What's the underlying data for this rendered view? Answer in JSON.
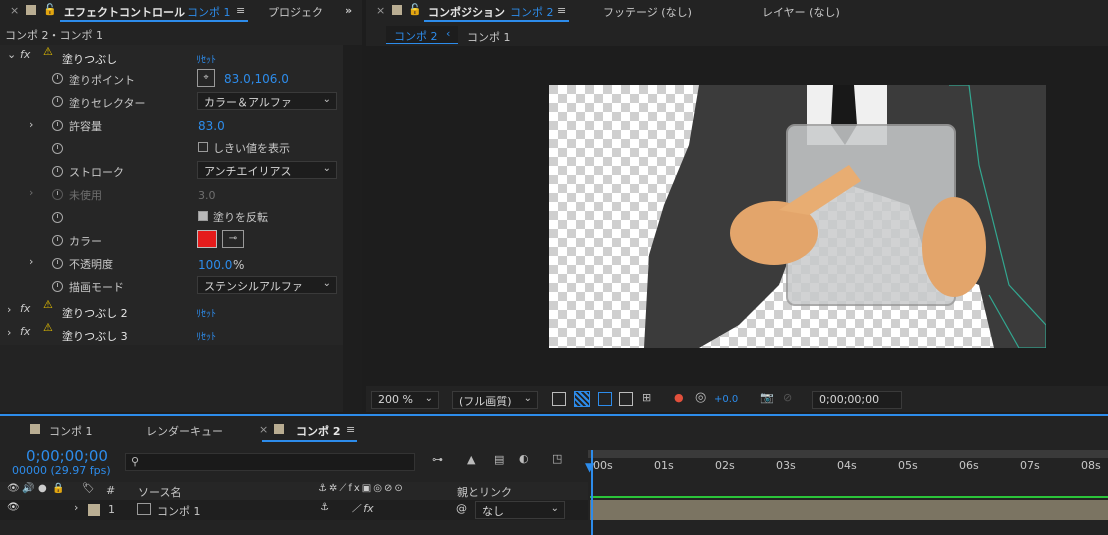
{
  "effect_panel": {
    "tab_label": "エフェクトコントロール",
    "tab_comp": "コンポ 1",
    "project_tab": "プロジェク",
    "header": "コンポ 2・コンポ 1",
    "effects": [
      {
        "name": "塗りつぶし",
        "reset": "ﾘｾｯﾄ"
      },
      {
        "name": "塗りつぶし 2",
        "reset": "ﾘｾｯﾄ"
      },
      {
        "name": "塗りつぶし 3",
        "reset": "ﾘｾｯﾄ"
      }
    ],
    "props": {
      "fill_point_label": "塗りポイント",
      "fill_point_value": "83.0,106.0",
      "selector_label": "塗りセレクター",
      "selector_value": "カラー＆アルファ",
      "tolerance_label": "許容量",
      "tolerance_value": "83.0",
      "threshold_label": "しきい値を表示",
      "stroke_label": "ストローク",
      "stroke_value": "アンチエイリアス",
      "unused_label": "未使用",
      "unused_value": "3.0",
      "invert_label": "塗りを反転",
      "color_label": "カラー",
      "color_value": "#e51c1c",
      "opacity_label": "不透明度",
      "opacity_value": "100.0",
      "opacity_unit": "%",
      "blend_label": "描画モード",
      "blend_value": "ステンシルアルファ"
    }
  },
  "comp_panel": {
    "tab_label": "コンポジション",
    "tab_comp": "コンポ 2",
    "footage_tab": "フッテージ (なし)",
    "layer_tab": "レイヤー (なし)",
    "breadcrumb_active": "コンポ 2",
    "breadcrumb_next": "コンポ 1",
    "zoom": "200 %",
    "quality": "(フル画質)",
    "exposure": "+0.0",
    "timecode": "0;00;00;00"
  },
  "timeline": {
    "tabs": [
      "コンポ 1",
      "レンダーキュー",
      "コンポ 2"
    ],
    "timecode": "0;00;00;00",
    "frame_info": "00000 (29.97 fps)",
    "ruler": [
      "00s",
      "01s",
      "02s",
      "03s",
      "04s",
      "05s",
      "06s",
      "07s",
      "08s"
    ],
    "columns": {
      "hash": "#",
      "source": "ソース名",
      "parent": "親とリンク"
    },
    "layer": {
      "number": "1",
      "name": "コンポ 1",
      "parent": "なし"
    }
  }
}
